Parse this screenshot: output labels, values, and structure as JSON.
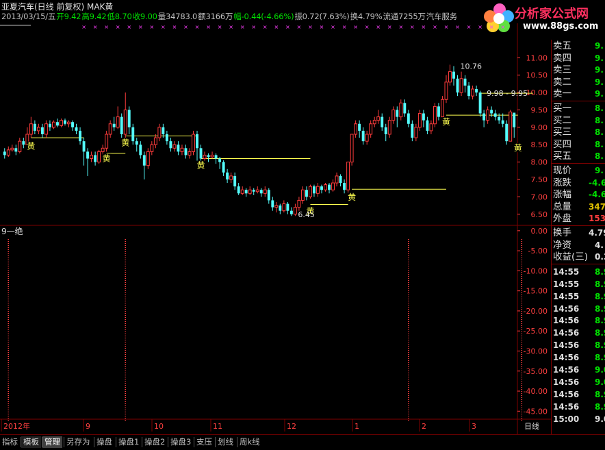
{
  "header": {
    "title": "亚夏汽车(日线 前复权) MAK黄",
    "info": [
      {
        "text": "2013/03/15/五",
        "color": "#c0c0c0"
      },
      {
        "text": "开9.42",
        "color": "#00e000"
      },
      {
        "text": "高9.42",
        "color": "#00e000"
      },
      {
        "text": "低8.70",
        "color": "#00e000"
      },
      {
        "text": "收9.00",
        "color": "#00e000"
      },
      {
        "text": "量34783.0",
        "color": "#c0c0c0"
      },
      {
        "text": "额3166万",
        "color": "#c0c0c0"
      },
      {
        "text": "幅-0.44(-4.66%)",
        "color": "#00e000"
      },
      {
        "text": "振0.72(7.63%)",
        "color": "#c0c0c0"
      },
      {
        "text": "换4.79%",
        "color": "#c0c0c0"
      },
      {
        "text": "流通7255万",
        "color": "#c0c0c0"
      },
      {
        "text": "汽车服务",
        "color": "#c0c0c0"
      }
    ]
  },
  "logo": {
    "name": "分析家公式网",
    "url": "www.88gs.com"
  },
  "colors": {
    "up": "#ff3c3c",
    "down": "#54fcfc",
    "grid": "#800000",
    "axis_text": "#ff4040",
    "yellow": "#ffff50",
    "green": "#00e000",
    "cross": "#ff40ff"
  },
  "chart_data": [
    {
      "type": "candlestick",
      "title": "亚夏汽车(日线 前复权)",
      "y_ticks": [
        "11.00",
        "10.50",
        "10.00",
        "9.50",
        "9.00",
        "8.50",
        "8.00",
        "7.50",
        "7.00",
        "6.50"
      ],
      "ylim": [
        6.2,
        11.4
      ],
      "x_labels": [
        "2012年",
        "9",
        "10",
        "11",
        "12",
        "1",
        "2",
        "3"
      ],
      "annotations": [
        {
          "text": "10.76",
          "x_index": 120,
          "y": 10.76
        },
        {
          "text": "9.98 - 9.95",
          "x_index": 127,
          "y": 9.98
        },
        {
          "text": "6.45",
          "x_index": 77,
          "y": 6.5
        }
      ],
      "marker_label": "黄",
      "markers": [
        {
          "x_index": 7,
          "y": 8.65
        },
        {
          "x_index": 27,
          "y": 8.3
        },
        {
          "x_index": 32,
          "y": 8.75
        },
        {
          "x_index": 52,
          "y": 8.1
        },
        {
          "x_index": 81,
          "y": 6.78
        },
        {
          "x_index": 92,
          "y": 7.18
        },
        {
          "x_index": 117,
          "y": 9.35
        },
        {
          "x_index": 136,
          "y": 8.6
        }
      ],
      "support_lines": [
        {
          "x_start": 7,
          "x_end": 21,
          "y": 8.7
        },
        {
          "x_start": 27,
          "x_end": 32,
          "y": 8.25
        },
        {
          "x_start": 32,
          "x_end": 51,
          "y": 8.75
        },
        {
          "x_start": 52,
          "x_end": 81,
          "y": 8.1
        },
        {
          "x_start": 81,
          "x_end": 91,
          "y": 6.78
        },
        {
          "x_start": 92,
          "x_end": 117,
          "y": 7.22
        },
        {
          "x_start": 117,
          "x_end": 136,
          "y": 9.35
        },
        {
          "x_start": 126,
          "x_end": 140,
          "y": 9.98
        }
      ],
      "candles": [
        [
          8.3,
          8.2,
          8.4,
          8.1
        ],
        [
          8.2,
          8.35,
          8.45,
          8.15
        ],
        [
          8.35,
          8.4,
          8.5,
          8.3
        ],
        [
          8.4,
          8.3,
          8.5,
          8.2
        ],
        [
          8.3,
          8.6,
          8.7,
          8.25
        ],
        [
          8.6,
          8.5,
          8.7,
          8.4
        ],
        [
          8.5,
          8.8,
          9.0,
          8.45
        ],
        [
          8.8,
          9.1,
          9.3,
          8.7
        ],
        [
          9.1,
          8.9,
          9.2,
          8.8
        ],
        [
          8.9,
          9.0,
          9.1,
          8.8
        ],
        [
          9.0,
          8.8,
          9.1,
          8.7
        ],
        [
          8.8,
          9.1,
          9.2,
          8.7
        ],
        [
          9.1,
          9.0,
          9.2,
          8.9
        ],
        [
          9.0,
          9.15,
          9.2,
          8.95
        ],
        [
          9.15,
          9.05,
          9.25,
          9.0
        ],
        [
          9.05,
          9.2,
          9.25,
          9.0
        ],
        [
          9.2,
          9.1,
          9.25,
          9.05
        ],
        [
          9.1,
          9.15,
          9.2,
          9.0
        ],
        [
          9.15,
          9.0,
          9.2,
          8.9
        ],
        [
          9.0,
          8.9,
          9.1,
          8.8
        ],
        [
          8.9,
          8.6,
          9.0,
          8.5
        ],
        [
          8.6,
          8.3,
          8.7,
          7.9
        ],
        [
          8.3,
          8.1,
          8.4,
          7.6
        ],
        [
          8.1,
          8.2,
          8.3,
          8.0
        ],
        [
          8.2,
          8.0,
          8.3,
          7.9
        ],
        [
          8.0,
          8.3,
          8.35,
          7.95
        ],
        [
          8.3,
          8.4,
          8.5,
          8.2
        ],
        [
          8.4,
          8.8,
          8.9,
          8.3
        ],
        [
          8.8,
          9.1,
          9.2,
          8.7
        ],
        [
          9.1,
          9.0,
          9.3,
          8.9
        ],
        [
          9.0,
          9.3,
          9.6,
          8.95
        ],
        [
          9.3,
          8.8,
          9.4,
          8.7
        ],
        [
          8.8,
          9.5,
          10.0,
          8.7
        ],
        [
          9.5,
          9.0,
          9.6,
          8.8
        ],
        [
          9.0,
          8.6,
          9.1,
          8.5
        ],
        [
          8.6,
          8.5,
          8.7,
          8.3
        ],
        [
          8.5,
          8.2,
          8.6,
          8.1
        ],
        [
          8.2,
          7.9,
          8.3,
          7.5
        ],
        [
          7.9,
          8.3,
          8.4,
          7.8
        ],
        [
          8.3,
          8.5,
          8.6,
          8.2
        ],
        [
          8.5,
          8.7,
          8.8,
          8.4
        ],
        [
          8.7,
          9.0,
          9.1,
          8.6
        ],
        [
          9.0,
          8.8,
          9.1,
          8.7
        ],
        [
          8.8,
          8.6,
          8.9,
          8.5
        ],
        [
          8.6,
          8.4,
          8.7,
          8.3
        ],
        [
          8.4,
          8.5,
          8.6,
          8.3
        ],
        [
          8.5,
          8.3,
          8.6,
          8.2
        ],
        [
          8.3,
          8.4,
          8.5,
          8.2
        ],
        [
          8.4,
          8.2,
          8.5,
          8.1
        ],
        [
          8.2,
          8.3,
          8.4,
          8.1
        ],
        [
          8.3,
          8.8,
          8.9,
          8.2
        ],
        [
          8.8,
          8.4,
          8.9,
          8.0
        ],
        [
          8.4,
          8.1,
          8.5,
          8.0
        ],
        [
          8.1,
          8.2,
          8.3,
          8.0
        ],
        [
          8.2,
          8.15,
          8.25,
          8.0
        ],
        [
          8.15,
          8.2,
          8.3,
          8.1
        ],
        [
          8.2,
          8.1,
          8.25,
          7.95
        ],
        [
          8.1,
          8.0,
          8.15,
          7.8
        ],
        [
          8.0,
          7.7,
          8.05,
          7.6
        ],
        [
          7.7,
          7.5,
          7.8,
          7.4
        ],
        [
          7.5,
          7.6,
          7.7,
          7.4
        ],
        [
          7.6,
          7.3,
          7.7,
          7.2
        ],
        [
          7.3,
          7.1,
          7.4,
          7.05
        ],
        [
          7.1,
          7.2,
          7.3,
          7.05
        ],
        [
          7.2,
          7.1,
          7.25,
          7.0
        ],
        [
          7.1,
          7.2,
          7.3,
          7.05
        ],
        [
          7.2,
          7.15,
          7.25,
          7.05
        ],
        [
          7.15,
          7.2,
          7.3,
          7.1
        ],
        [
          7.2,
          7.1,
          7.25,
          7.0
        ],
        [
          7.1,
          7.2,
          7.3,
          7.0
        ],
        [
          7.2,
          6.9,
          7.25,
          6.8
        ],
        [
          6.9,
          6.7,
          7.0,
          6.6
        ],
        [
          6.7,
          6.75,
          6.85,
          6.55
        ],
        [
          6.75,
          6.6,
          6.8,
          6.5
        ],
        [
          6.6,
          6.8,
          6.9,
          6.55
        ],
        [
          6.8,
          6.6,
          6.85,
          6.5
        ],
        [
          6.6,
          6.5,
          6.7,
          6.45
        ],
        [
          6.5,
          6.7,
          6.8,
          6.45
        ],
        [
          6.7,
          6.9,
          7.0,
          6.6
        ],
        [
          6.9,
          7.2,
          7.3,
          6.8
        ],
        [
          7.2,
          7.0,
          7.3,
          6.9
        ],
        [
          7.0,
          7.3,
          7.35,
          6.95
        ],
        [
          7.3,
          7.1,
          7.35,
          7.0
        ],
        [
          7.1,
          7.3,
          7.4,
          7.0
        ],
        [
          7.3,
          7.2,
          7.35,
          7.1
        ],
        [
          7.2,
          7.35,
          7.4,
          7.15
        ],
        [
          7.35,
          7.2,
          7.4,
          7.1
        ],
        [
          7.2,
          7.4,
          7.5,
          7.15
        ],
        [
          7.4,
          7.6,
          7.7,
          7.3
        ],
        [
          7.6,
          7.4,
          7.65,
          7.3
        ],
        [
          7.4,
          7.2,
          7.5,
          7.1
        ],
        [
          7.2,
          8.0,
          8.0,
          7.1
        ],
        [
          8.0,
          8.8,
          8.8,
          7.9
        ],
        [
          8.8,
          9.1,
          9.2,
          8.7
        ],
        [
          9.1,
          8.9,
          9.2,
          8.7
        ],
        [
          8.9,
          8.6,
          9.0,
          8.5
        ],
        [
          8.6,
          8.8,
          8.9,
          8.5
        ],
        [
          8.8,
          9.1,
          9.2,
          8.7
        ],
        [
          9.1,
          9.2,
          9.3,
          9.0
        ],
        [
          9.2,
          9.3,
          9.5,
          9.1
        ],
        [
          9.3,
          9.0,
          9.4,
          8.9
        ],
        [
          9.0,
          8.8,
          9.1,
          8.6
        ],
        [
          8.8,
          9.2,
          9.3,
          8.7
        ],
        [
          9.2,
          9.5,
          9.6,
          9.1
        ],
        [
          9.5,
          9.3,
          9.6,
          9.0
        ],
        [
          9.3,
          9.7,
          9.8,
          9.2
        ],
        [
          9.7,
          9.4,
          9.8,
          9.3
        ],
        [
          9.4,
          9.1,
          9.5,
          9.0
        ],
        [
          9.1,
          8.7,
          9.2,
          8.6
        ],
        [
          8.7,
          9.0,
          9.1,
          8.6
        ],
        [
          9.0,
          9.4,
          9.5,
          8.9
        ],
        [
          9.4,
          9.2,
          9.5,
          9.0
        ],
        [
          9.2,
          8.9,
          9.3,
          8.8
        ],
        [
          8.9,
          9.1,
          9.2,
          8.8
        ],
        [
          9.1,
          9.6,
          9.7,
          9.0
        ],
        [
          9.6,
          9.3,
          9.7,
          9.2
        ],
        [
          9.3,
          9.8,
          9.9,
          9.2
        ],
        [
          9.8,
          10.3,
          10.5,
          9.7
        ],
        [
          10.3,
          10.6,
          10.8,
          10.2
        ],
        [
          10.6,
          10.4,
          10.76,
          10.2
        ],
        [
          10.4,
          10.0,
          10.5,
          9.9
        ],
        [
          10.0,
          10.4,
          10.6,
          9.9
        ],
        [
          10.4,
          10.2,
          10.5,
          10.0
        ],
        [
          10.2,
          9.9,
          10.3,
          9.8
        ],
        [
          9.9,
          10.1,
          10.2,
          9.8
        ],
        [
          10.1,
          10.0,
          10.2,
          9.9
        ],
        [
          10.0,
          9.4,
          10.05,
          9.3
        ],
        [
          9.4,
          9.2,
          9.5,
          9.0
        ],
        [
          9.2,
          9.5,
          9.6,
          9.1
        ],
        [
          9.5,
          9.4,
          9.6,
          9.3
        ],
        [
          9.4,
          9.3,
          9.5,
          9.2
        ],
        [
          9.3,
          9.2,
          9.4,
          9.1
        ],
        [
          9.2,
          9.1,
          9.4,
          9.0
        ],
        [
          9.1,
          8.6,
          9.2,
          8.5
        ],
        [
          8.6,
          9.44,
          9.5,
          8.6
        ],
        [
          9.42,
          9.0,
          9.42,
          8.7
        ]
      ]
    },
    {
      "type": "indicator",
      "title": "9一绝",
      "y_ticks": [
        "0.00",
        "-5.00",
        "-10.00",
        "-15.00",
        "-20.00",
        "-25.00",
        "-30.00",
        "-35.00",
        "-40.00",
        "-45.00"
      ],
      "ylim": [
        -47,
        1
      ],
      "signal_x_indices": [
        1,
        32,
        107,
        137
      ]
    }
  ],
  "right_panel": {
    "quote_rows": [
      {
        "label": "卖五",
        "value": "9.",
        "color": "#00e000"
      },
      {
        "label": "卖四",
        "value": "9.",
        "color": "#00e000"
      },
      {
        "label": "卖三",
        "value": "9.",
        "color": "#00e000"
      },
      {
        "label": "卖二",
        "value": "9.",
        "color": "#00e000"
      },
      {
        "label": "卖一",
        "value": "9.",
        "color": "#00e000"
      },
      {
        "label": "买一",
        "value": "8.",
        "color": "#00e000"
      },
      {
        "label": "买二",
        "value": "8.",
        "color": "#00e000"
      },
      {
        "label": "买三",
        "value": "8.",
        "color": "#00e000"
      },
      {
        "label": "买四",
        "value": "8.",
        "color": "#00e000"
      },
      {
        "label": "买五",
        "value": "8.",
        "color": "#00e000"
      },
      {
        "label": "现价",
        "value": "9.",
        "color": "#00e000"
      },
      {
        "label": "涨跌",
        "value": "-4.6",
        "color": "#00e000",
        "wide": true
      },
      {
        "label": "涨幅",
        "value": "-4.6",
        "color": "#00e000",
        "wide": true
      },
      {
        "label": "总量",
        "value": "347",
        "color": "#e0c000",
        "wide": true
      },
      {
        "label": "外盘",
        "value": "153",
        "color": "#ff3c3c",
        "wide": true
      },
      {
        "label": "换手",
        "value": "4.79",
        "color": "#e0e0e0",
        "wide": true
      },
      {
        "label": "净资",
        "value": "4.",
        "color": "#e0e0e0"
      },
      {
        "label": "收益(三)",
        "value": "0.3",
        "color": "#e0e0e0"
      }
    ],
    "trades": [
      {
        "time": "14:55",
        "price": "8.9",
        "color": "#00e000"
      },
      {
        "time": "14:55",
        "price": "8.9",
        "color": "#00e000"
      },
      {
        "time": "14:55",
        "price": "8.9",
        "color": "#00e000"
      },
      {
        "time": "14:56",
        "price": "8.9",
        "color": "#00e000"
      },
      {
        "time": "14:56",
        "price": "8.9",
        "color": "#00e000"
      },
      {
        "time": "14:56",
        "price": "8.9",
        "color": "#00e000"
      },
      {
        "time": "14:56",
        "price": "8.9",
        "color": "#00e000"
      },
      {
        "time": "14:56",
        "price": "8.9",
        "color": "#00e000"
      },
      {
        "time": "14:56",
        "price": "9.0",
        "color": "#00e000"
      },
      {
        "time": "14:56",
        "price": "9.0",
        "color": "#00e000"
      },
      {
        "time": "14:56",
        "price": "8.9",
        "color": "#00e000"
      },
      {
        "time": "14:56",
        "price": "8.9",
        "color": "#00e000"
      },
      {
        "time": "15:00",
        "price": "9.0",
        "color": "#e0e0e0"
      }
    ]
  },
  "bottom_tabs": [
    {
      "label": "指标",
      "state": "normal"
    },
    {
      "label": "模板",
      "state": "selected"
    },
    {
      "label": "管理",
      "state": "active"
    },
    {
      "label": "另存为",
      "state": "normal"
    },
    {
      "label": "操盘",
      "state": "normal"
    },
    {
      "label": "操盘1",
      "state": "normal"
    },
    {
      "label": "操盘2",
      "state": "normal"
    },
    {
      "label": "操盘3",
      "state": "normal"
    },
    {
      "label": "支压",
      "state": "normal"
    },
    {
      "label": "划线",
      "state": "normal"
    },
    {
      "label": "周k线",
      "state": "normal"
    }
  ],
  "period_label": "日线"
}
